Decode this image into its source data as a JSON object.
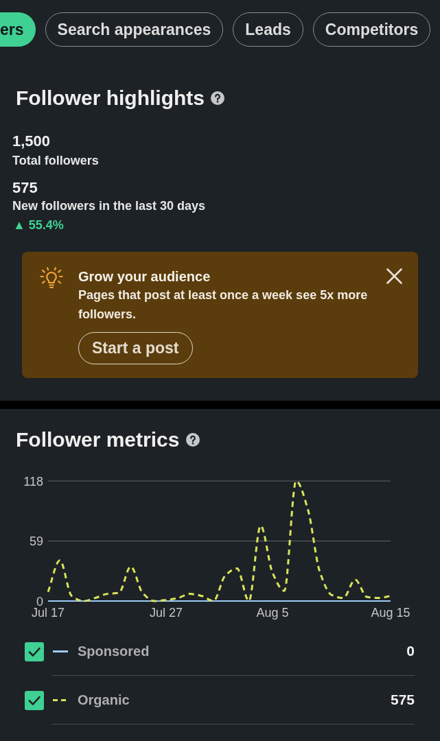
{
  "tabs": [
    {
      "label": "ers",
      "selected": true
    },
    {
      "label": "Search appearances",
      "selected": false
    },
    {
      "label": "Leads",
      "selected": false
    },
    {
      "label": "Competitors",
      "selected": false
    }
  ],
  "highlights": {
    "title": "Follower highlights",
    "stats": [
      {
        "value": "1,500",
        "label": "Total followers"
      },
      {
        "value": "575",
        "label": "New followers in the last 30 days",
        "change": "▲ 55.4%"
      }
    ]
  },
  "tip_card": {
    "title": "Grow your audience",
    "body": "Pages that post at least once a week see 5x more followers.",
    "button": "Start a post"
  },
  "metrics": {
    "title": "Follower metrics",
    "chart_data": {
      "type": "line",
      "categories": [
        "Jul 17",
        null,
        null,
        null,
        null,
        null,
        null,
        null,
        null,
        null,
        "Jul 27",
        null,
        null,
        null,
        null,
        null,
        null,
        null,
        null,
        "Aug 5",
        null,
        null,
        null,
        null,
        null,
        null,
        null,
        null,
        null,
        "Aug 15"
      ],
      "ylim": [
        0,
        118
      ],
      "yticks": [
        0,
        59,
        118
      ],
      "series": [
        {
          "name": "Sponsored",
          "color": "#9ecbf5",
          "line_style": "solid",
          "values": [
            0,
            0,
            0,
            0,
            0,
            0,
            0,
            0,
            0,
            0,
            0,
            0,
            0,
            0,
            0,
            0,
            0,
            0,
            0,
            0,
            0,
            0,
            0,
            0,
            0,
            0,
            0,
            0,
            0,
            0
          ]
        },
        {
          "name": "Organic",
          "color": "#d8e35a",
          "line_style": "dashed",
          "values": [
            9,
            40,
            5,
            0,
            3,
            7,
            8,
            34,
            8,
            0,
            1,
            3,
            7,
            5,
            0,
            25,
            32,
            0,
            74,
            28,
            10,
            118,
            90,
            29,
            6,
            3,
            21,
            4,
            3,
            5
          ]
        }
      ]
    },
    "legend": [
      {
        "total": "0",
        "checked": true
      },
      {
        "total": "575",
        "checked": true
      }
    ]
  }
}
